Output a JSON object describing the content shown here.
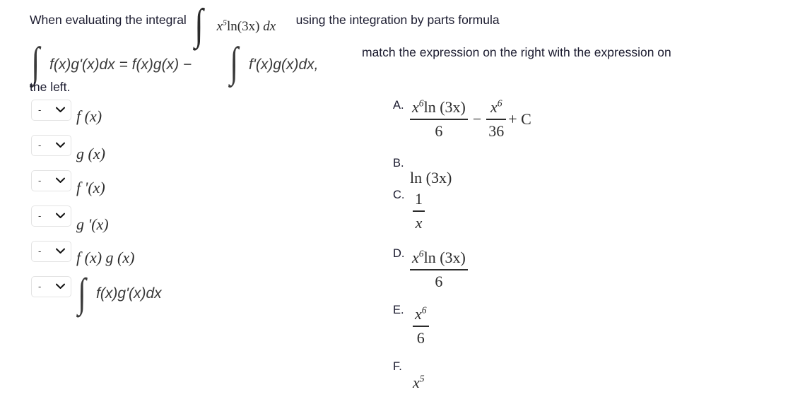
{
  "prompt": {
    "part1": "When evaluating the integral ",
    "integral_expression": {
      "symbol": "∫",
      "integrand_base": "x",
      "integrand_exponent": "5",
      "log": "ln",
      "log_arg": "(3x)",
      "differential": "dx"
    },
    "part2": "using the integration by parts formula",
    "ibp_formula": {
      "int1_symbol": "∫",
      "seg_a": "f(x)g'(x)dx = f(x)g(x) −",
      "int2_symbol": "∫",
      "seg_b": "f'(x)g(x)dx,"
    },
    "part3": "match the expression on the right with the expression on",
    "part4": "the left."
  },
  "dropdown": {
    "selected_value": "-",
    "chevron_icon": "chevron-down-icon"
  },
  "left_items": [
    {
      "id": "f-of-x",
      "kind": "plain",
      "text": "f (x)"
    },
    {
      "id": "g-of-x",
      "kind": "plain",
      "text": "g (x)"
    },
    {
      "id": "f-prime-of-x",
      "kind": "plain",
      "text": "f '(x)"
    },
    {
      "id": "g-prime-of-x",
      "kind": "plain",
      "text": "g '(x)"
    },
    {
      "id": "f-times-g",
      "kind": "plain",
      "text": "f (x) g (x)"
    },
    {
      "id": "integral-fg",
      "kind": "integral",
      "symbol": "∫",
      "text": "f(x)g'(x)dx"
    }
  ],
  "options": [
    {
      "letter": "A.",
      "id": "option-a",
      "parts": {
        "frac1_num_base": "x",
        "frac1_num_exp": "6",
        "frac1_num_log": "ln (3x)",
        "frac1_den": "6",
        "operator": "−",
        "frac2_num_base": "x",
        "frac2_num_exp": "6",
        "frac2_den": "36",
        "tail": "+ C"
      }
    },
    {
      "letter": "B.",
      "id": "option-b",
      "parts": {
        "text_log": "ln (3x)"
      }
    },
    {
      "letter": "C.",
      "id": "option-c",
      "parts": {
        "frac_num": "1",
        "frac_den": "x"
      }
    },
    {
      "letter": "D.",
      "id": "option-d",
      "parts": {
        "frac_num_base": "x",
        "frac_num_exp": "6",
        "frac_num_log": "ln (3x)",
        "frac_den": "6"
      }
    },
    {
      "letter": "E.",
      "id": "option-e",
      "parts": {
        "frac_num_base": "x",
        "frac_num_exp": "6",
        "frac_den": "6"
      }
    },
    {
      "letter": "F.",
      "id": "option-f",
      "parts": {
        "base": "x",
        "exp": "5"
      }
    }
  ],
  "colors": {
    "text": "#1b1b2f",
    "math": "#2b2b2b",
    "border": "#e3e3e3",
    "background": "#ffffff"
  }
}
